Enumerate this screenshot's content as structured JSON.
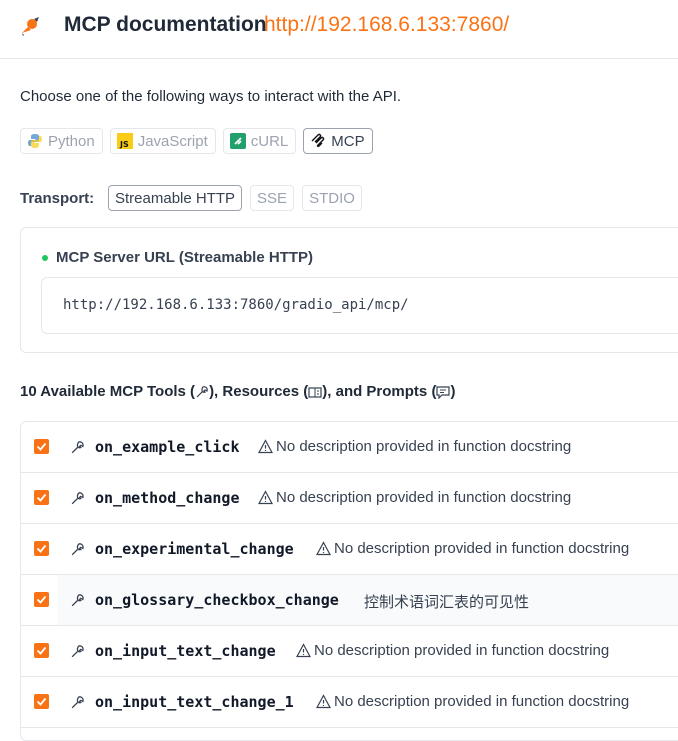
{
  "header": {
    "title": "MCP documentation",
    "url": "http://192.168.6.133:7860/"
  },
  "intro": "Choose one of the following ways to interact with the API.",
  "languages": [
    {
      "label": "Python",
      "icon": "python-icon",
      "active": false
    },
    {
      "label": "JavaScript",
      "icon": "javascript-icon",
      "active": false
    },
    {
      "label": "cURL",
      "icon": "curl-icon",
      "active": false
    },
    {
      "label": "MCP",
      "icon": "mcp-icon",
      "active": true
    }
  ],
  "transport": {
    "label": "Transport:",
    "options": [
      {
        "label": "Streamable HTTP",
        "active": true
      },
      {
        "label": "SSE",
        "active": false
      },
      {
        "label": "STDIO",
        "active": false
      }
    ]
  },
  "server": {
    "label": "MCP Server URL (Streamable HTTP)",
    "url": "http://192.168.6.133:7860/gradio_api/mcp/"
  },
  "tools_heading": {
    "part1": "10 Available MCP Tools (",
    "part2": "), Resources (",
    "part3": "), and Prompts (",
    "part4": ")"
  },
  "tools": [
    {
      "name": "on_example_click",
      "description": "No description provided in function docstring",
      "warning": true,
      "checked": true
    },
    {
      "name": "on_method_change",
      "description": "No description provided in function docstring",
      "warning": true,
      "checked": true
    },
    {
      "name": "on_experimental_change",
      "description": "No description provided in function docstring",
      "warning": true,
      "checked": true
    },
    {
      "name": "on_glossary_checkbox_change",
      "description": "控制术语词汇表的可见性",
      "warning": false,
      "checked": true
    },
    {
      "name": "on_input_text_change",
      "description": "No description provided in function docstring",
      "warning": true,
      "checked": true
    },
    {
      "name": "on_input_text_change_1",
      "description": "No description provided in function docstring",
      "warning": true,
      "checked": true
    }
  ],
  "colors": {
    "accent": "#f97316",
    "status_dot": "#22c55e"
  }
}
